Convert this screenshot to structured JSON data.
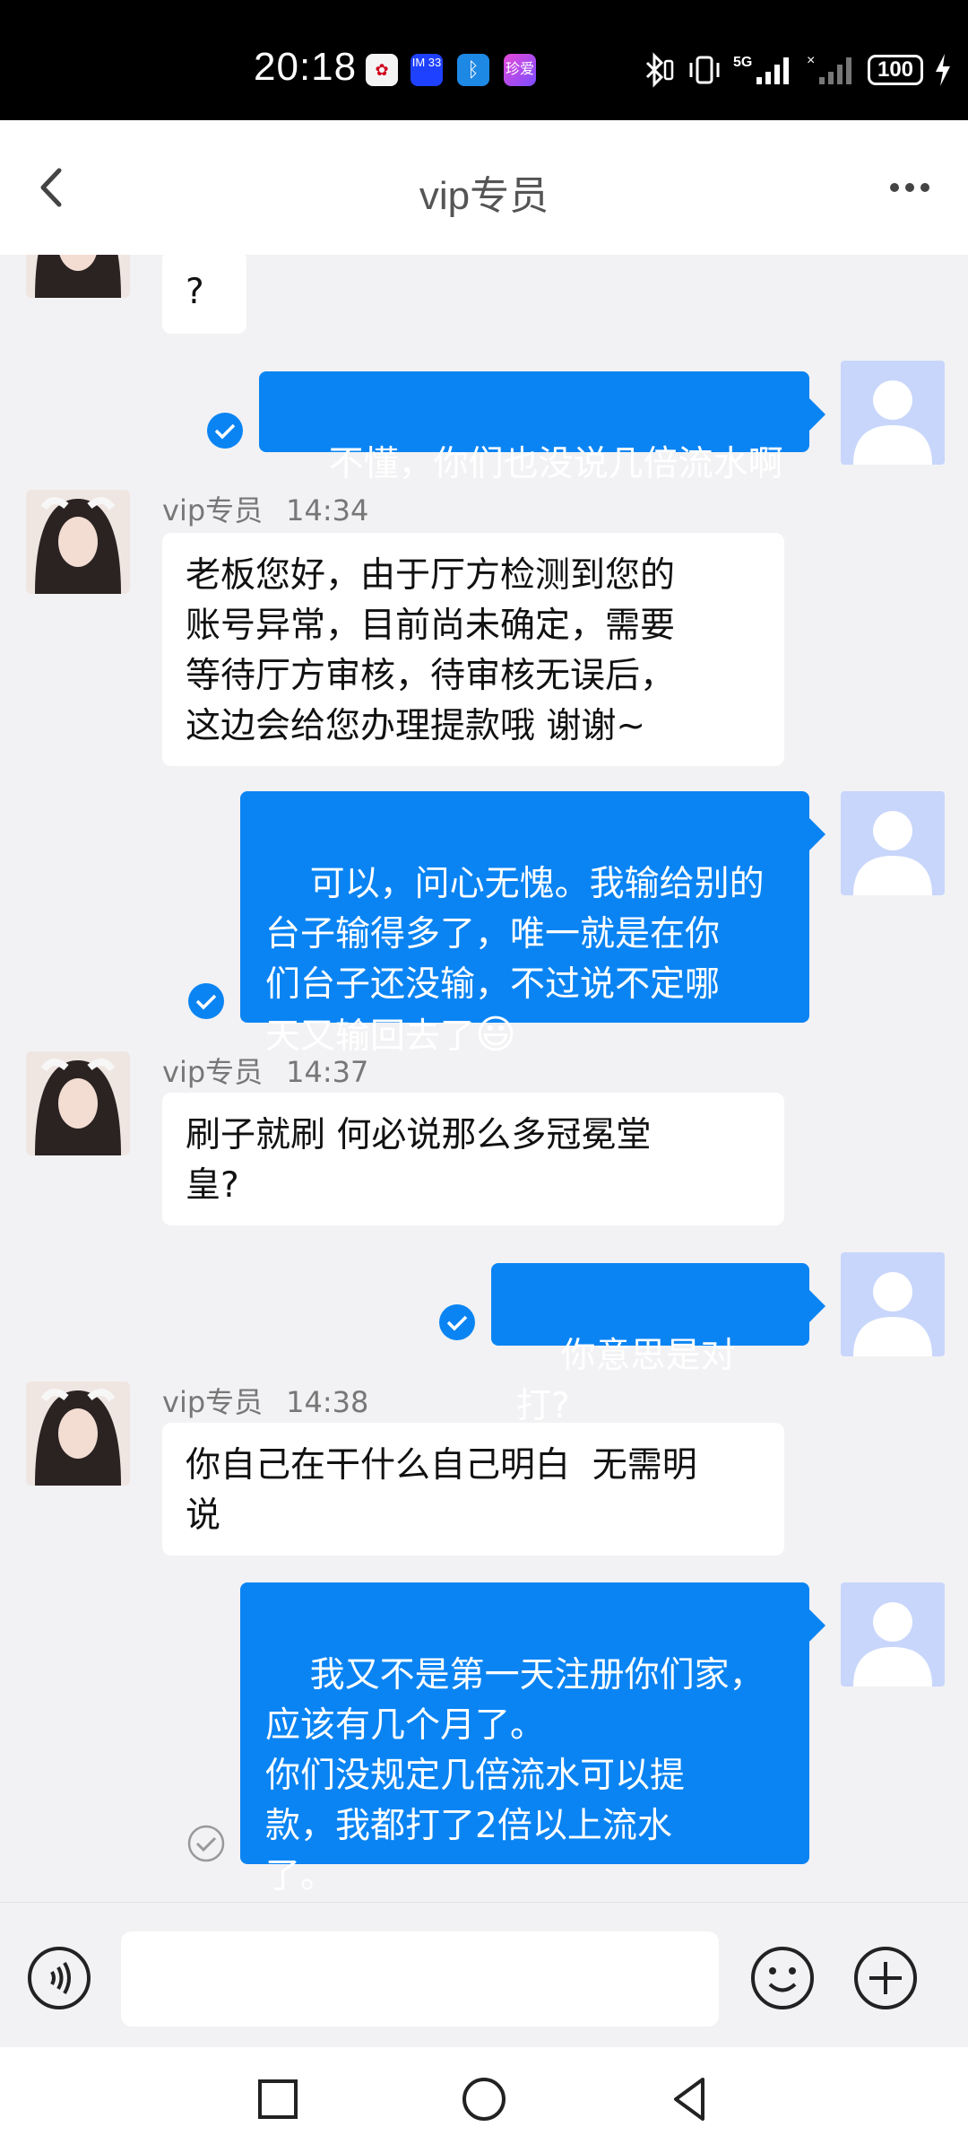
{
  "status_bar": {
    "time": "20:18",
    "apps": [
      "huawei",
      "IM 33",
      "bluetooth",
      "珍爱"
    ],
    "battery": "100"
  },
  "header": {
    "title": "vip专员"
  },
  "messages": [
    {
      "side": "left",
      "text": "?"
    },
    {
      "side": "right",
      "text": "不懂，你们也没说几倍流水啊",
      "status": "read"
    },
    {
      "side": "left",
      "sender": "vip专员",
      "time": "14:34",
      "text": "老板您好，由于厅方检测到您的\n账号异常，目前尚未确定，需要\n等待厅方审核，待审核无误后，\n这边会给您办理提款哦 谢谢~"
    },
    {
      "side": "right",
      "text": "可以，问心无愧。我输给别的\n台子输得多了，唯一就是在你\n们台子还没输，不过说不定哪\n天又输回去了",
      "emoji": "😃",
      "status": "read"
    },
    {
      "side": "left",
      "sender": "vip专员",
      "time": "14:37",
      "text": "刷子就刷 何必说那么多冠冕堂\n皇?"
    },
    {
      "side": "right",
      "text": "你意思是对打?",
      "status": "read"
    },
    {
      "side": "left",
      "sender": "vip专员",
      "time": "14:38",
      "text": "你自己在干什么自己明白  无需明\n说"
    },
    {
      "side": "right",
      "text": "我又不是第一天注册你们家，\n应该有几个月了。\n你们没规定几倍流水可以提\n款，我都打了2倍以上流水\n了。",
      "status": "sent"
    }
  ],
  "input": {
    "placeholder": ""
  },
  "icons": {
    "back": "back-arrow-icon",
    "more": "more-dots-icon",
    "voice": "voice-icon",
    "emoji": "emoji-icon",
    "plus": "plus-icon"
  },
  "colors": {
    "accent": "#0a84f3",
    "avatar_placeholder": "#c8d6fb"
  }
}
